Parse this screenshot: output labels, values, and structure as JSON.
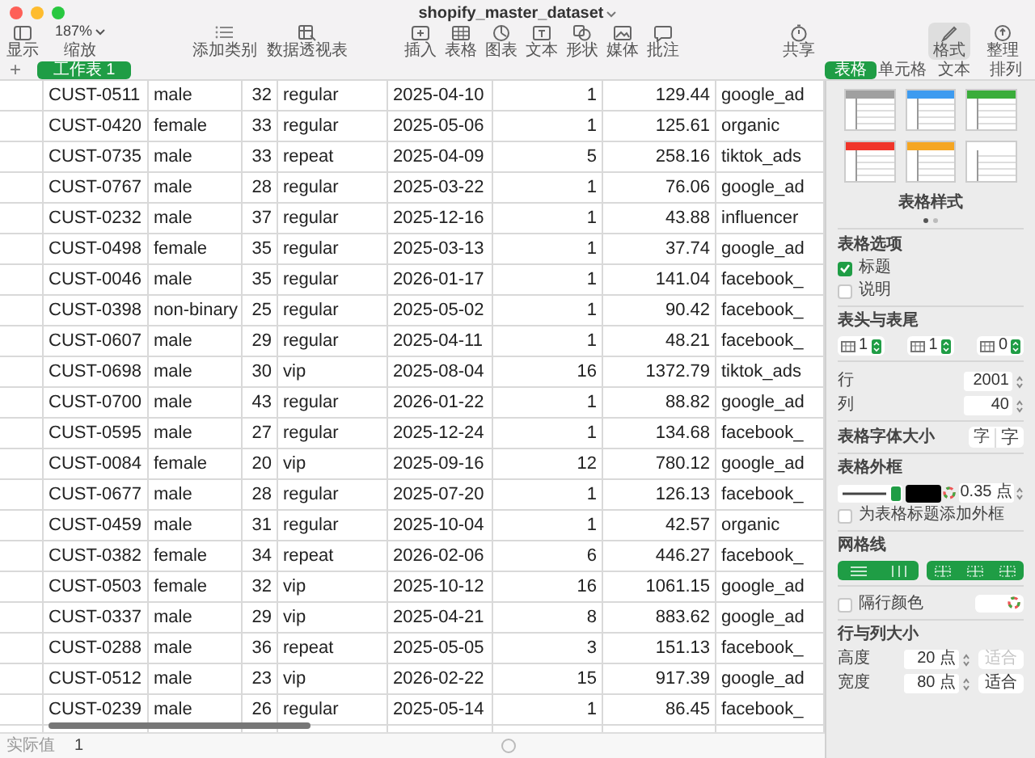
{
  "window": {
    "title": "shopify_master_dataset"
  },
  "toolbar": {
    "groups": [
      [
        {
          "kind": "button",
          "label": "显示",
          "selected": false
        },
        {
          "kind": "zoom",
          "value": "187%",
          "label": "缩放",
          "selected": false
        }
      ],
      [
        {
          "kind": "button",
          "label": "添加类别",
          "selected": false
        },
        {
          "kind": "button",
          "label": "数据透视表",
          "selected": false
        }
      ],
      [
        {
          "kind": "button",
          "label": "插入",
          "selected": false
        },
        {
          "kind": "button",
          "label": "表格",
          "selected": false
        },
        {
          "kind": "button",
          "label": "图表",
          "selected": false
        },
        {
          "kind": "button",
          "label": "文本",
          "selected": false
        },
        {
          "kind": "button",
          "label": "形状",
          "selected": false
        },
        {
          "kind": "button",
          "label": "媒体",
          "selected": false
        },
        {
          "kind": "button",
          "label": "批注",
          "selected": false
        }
      ],
      [
        {
          "kind": "button",
          "label": "共享",
          "selected": false
        }
      ],
      [
        {
          "kind": "button",
          "label": "格式",
          "selected": true
        },
        {
          "kind": "button",
          "label": "整理",
          "selected": false
        }
      ]
    ]
  },
  "sheets": {
    "add": "+",
    "tabs": [
      {
        "label": "工作表 1",
        "selected": true
      }
    ]
  },
  "table": {
    "rows": [
      [
        "CUST-0511",
        "male",
        "32",
        "regular",
        "2025-04-10",
        "1",
        "129.44",
        "google_ad"
      ],
      [
        "CUST-0420",
        "female",
        "33",
        "regular",
        "2025-05-06",
        "1",
        "125.61",
        "organic"
      ],
      [
        "CUST-0735",
        "male",
        "33",
        "repeat",
        "2025-04-09",
        "5",
        "258.16",
        "tiktok_ads"
      ],
      [
        "CUST-0767",
        "male",
        "28",
        "regular",
        "2025-03-22",
        "1",
        "76.06",
        "google_ad"
      ],
      [
        "CUST-0232",
        "male",
        "37",
        "regular",
        "2025-12-16",
        "1",
        "43.88",
        "influencer"
      ],
      [
        "CUST-0498",
        "female",
        "35",
        "regular",
        "2025-03-13",
        "1",
        "37.74",
        "google_ad"
      ],
      [
        "CUST-0046",
        "male",
        "35",
        "regular",
        "2026-01-17",
        "1",
        "141.04",
        "facebook_"
      ],
      [
        "CUST-0398",
        "non-binary",
        "25",
        "regular",
        "2025-05-02",
        "1",
        "90.42",
        "facebook_"
      ],
      [
        "CUST-0607",
        "male",
        "29",
        "regular",
        "2025-04-11",
        "1",
        "48.21",
        "facebook_"
      ],
      [
        "CUST-0698",
        "male",
        "30",
        "vip",
        "2025-08-04",
        "16",
        "1372.79",
        "tiktok_ads"
      ],
      [
        "CUST-0700",
        "male",
        "43",
        "regular",
        "2026-01-22",
        "1",
        "88.82",
        "google_ad"
      ],
      [
        "CUST-0595",
        "male",
        "27",
        "regular",
        "2025-12-24",
        "1",
        "134.68",
        "facebook_"
      ],
      [
        "CUST-0084",
        "female",
        "20",
        "vip",
        "2025-09-16",
        "12",
        "780.12",
        "google_ad"
      ],
      [
        "CUST-0677",
        "male",
        "28",
        "regular",
        "2025-07-20",
        "1",
        "126.13",
        "facebook_"
      ],
      [
        "CUST-0459",
        "male",
        "31",
        "regular",
        "2025-10-04",
        "1",
        "42.57",
        "organic"
      ],
      [
        "CUST-0382",
        "female",
        "34",
        "repeat",
        "2026-02-06",
        "6",
        "446.27",
        "facebook_"
      ],
      [
        "CUST-0503",
        "female",
        "32",
        "vip",
        "2025-10-12",
        "16",
        "1061.15",
        "google_ad"
      ],
      [
        "CUST-0337",
        "male",
        "29",
        "vip",
        "2025-04-21",
        "8",
        "883.62",
        "google_ad"
      ],
      [
        "CUST-0288",
        "male",
        "36",
        "repeat",
        "2025-05-05",
        "3",
        "151.13",
        "facebook_"
      ],
      [
        "CUST-0512",
        "male",
        "23",
        "vip",
        "2026-02-22",
        "15",
        "917.39",
        "google_ad"
      ],
      [
        "CUST-0239",
        "male",
        "26",
        "regular",
        "2025-05-14",
        "1",
        "86.45",
        "facebook_"
      ]
    ]
  },
  "status_bar": {
    "label": "实际值",
    "value": "1"
  },
  "panel": {
    "tabs": [
      {
        "label": "表格",
        "selected": true
      },
      {
        "label": "单元格",
        "selected": false
      },
      {
        "label": "文本",
        "selected": false
      },
      {
        "label": "排列",
        "selected": false
      }
    ],
    "styles": [
      {
        "color": "#a0a0a0"
      },
      {
        "color": "#3d9bf0"
      },
      {
        "color": "#3aad3a"
      },
      {
        "color": "#f0352a"
      },
      {
        "color": "#f5a623"
      },
      {
        "color": "#ffffff"
      }
    ],
    "styles_label": "表格样式",
    "pages": [
      {
        "selected": true
      },
      {
        "selected": false
      }
    ],
    "table_options": {
      "heading": "表格选项",
      "options": [
        {
          "label": "标题",
          "checked": true
        },
        {
          "label": "说明",
          "checked": false
        }
      ]
    },
    "header_footer": {
      "heading": "表头与表尾",
      "steppers": [
        {
          "value": "1"
        },
        {
          "value": "1"
        },
        {
          "value": "0"
        }
      ]
    },
    "size_fields": [
      {
        "label": "行",
        "value": "2001"
      },
      {
        "label": "列",
        "value": "40"
      }
    ],
    "font_size": {
      "label": "表格字体大小",
      "smaller": "字",
      "larger": "字"
    },
    "outline": {
      "heading": "表格外框",
      "color": "#000000",
      "width": "0.35 点",
      "title_outline": {
        "label": "为表格标题添加外框",
        "checked": false
      }
    },
    "gridlines": {
      "heading": "网格线"
    },
    "alternating": {
      "label": "隔行颜色",
      "checked": false
    },
    "sizes": {
      "heading": "行与列大小",
      "items": [
        {
          "label": "高度",
          "value": "20 点",
          "fit": "适合",
          "disabled": true
        },
        {
          "label": "宽度",
          "value": "80 点",
          "fit": "适合",
          "disabled": false
        }
      ]
    }
  }
}
